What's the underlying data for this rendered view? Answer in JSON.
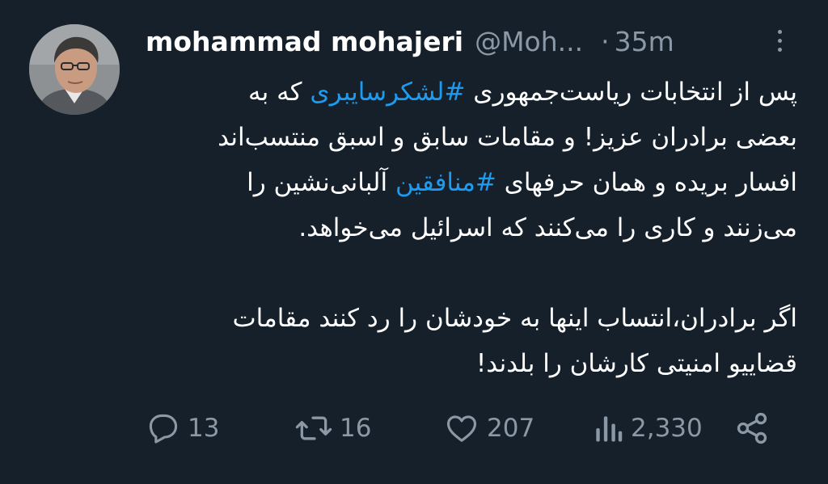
{
  "author": {
    "name": "mohammad mohajeri",
    "handle": "@Moh...",
    "separator": "·",
    "time": "35m"
  },
  "tweet": {
    "lines_p1": [
      [
        "پس از انتخابات ریاست‌جمهوری ",
        "#لشکرسایبری",
        " که به"
      ],
      [
        "بعضی برادران عزیز! و مقامات سابق و اسبق منتسب‌اند",
        "",
        ""
      ],
      [
        "افسار بریده و همان حرفهای ",
        "#منافقین",
        " آلبانی‌نشین را"
      ],
      [
        "می‌زنند و کاری را می‌کنند که اسرائیل می‌خواهد.",
        "",
        ""
      ]
    ],
    "lines_p2": [
      "اگر برادران،انتساب اینها به خودشان را رد کنند مقامات",
      "قضاییو امنیتی کارشان را بلدند!"
    ]
  },
  "stats": {
    "replies": "13",
    "retweets": "16",
    "likes": "207",
    "views": "2,330"
  },
  "icons": {
    "reply": "reply-icon",
    "retweet": "retweet-icon",
    "like": "heart-icon",
    "views": "views-icon",
    "share": "share-icon",
    "more": "more-icon"
  },
  "colors": {
    "background": "#15202b",
    "text": "#ffffff",
    "muted": "#8b98a5",
    "hashtag": "#1d9bf0"
  }
}
